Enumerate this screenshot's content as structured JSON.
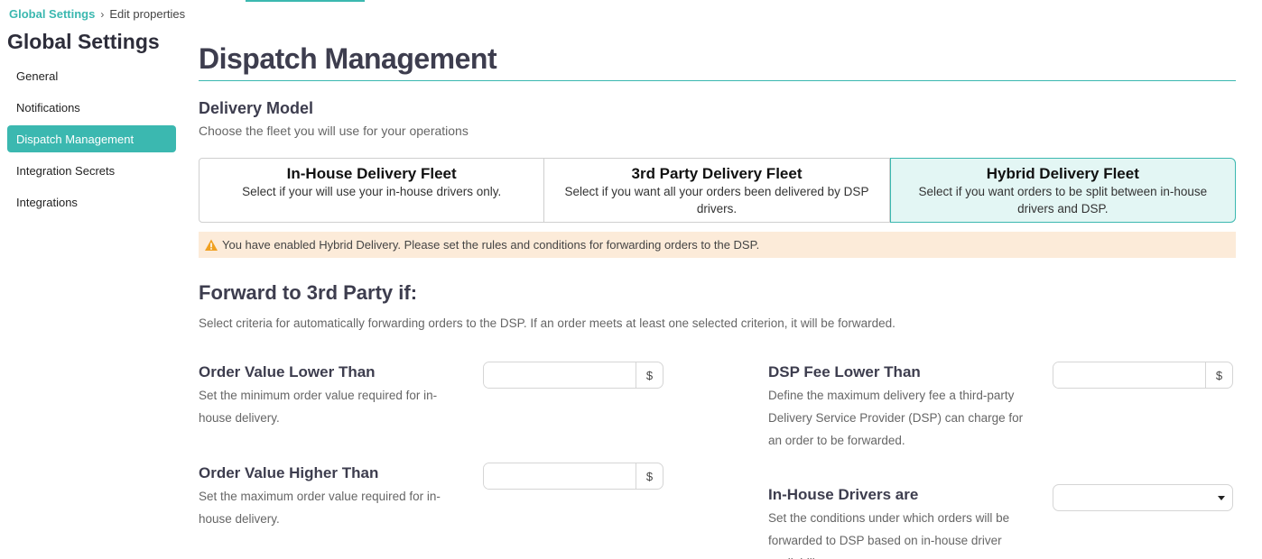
{
  "breadcrumb": {
    "root": "Global Settings",
    "separator": "›",
    "current": "Edit properties"
  },
  "sidebar": {
    "title": "Global Settings",
    "items": [
      {
        "label": "General",
        "active": false
      },
      {
        "label": "Notifications",
        "active": false
      },
      {
        "label": "Dispatch Management",
        "active": true
      },
      {
        "label": "Integration Secrets",
        "active": false
      },
      {
        "label": "Integrations",
        "active": false
      }
    ]
  },
  "page": {
    "title": "Dispatch Management"
  },
  "delivery_model": {
    "heading": "Delivery Model",
    "subtitle": "Choose the fleet you will use for your operations",
    "options": [
      {
        "title": "In-House Delivery Fleet",
        "description": "Select if your will use your in-house drivers only.",
        "selected": false
      },
      {
        "title": "3rd Party Delivery Fleet",
        "description": "Select if you want all your orders been delivered by DSP drivers.",
        "selected": false
      },
      {
        "title": "Hybrid Delivery Fleet",
        "description": "Select if you want orders to be split between in-house drivers and DSP.",
        "selected": true
      }
    ]
  },
  "alert": {
    "icon": "warning-icon",
    "text": "You have enabled Hybrid Delivery. Please set the rules and conditions for forwarding orders to the DSP."
  },
  "forward": {
    "heading": "Forward to 3rd Party if:",
    "subtitle": "Select criteria for automatically forwarding orders to the DSP. If an order meets at least one selected criterion, it will be forwarded.",
    "criteria": {
      "order_value_lower": {
        "title": "Order Value Lower Than",
        "description": "Set the minimum order value required for in-house delivery.",
        "value": "",
        "suffix": "$"
      },
      "order_value_higher": {
        "title": "Order Value Higher Than",
        "description": "Set the maximum order value required for in-house delivery.",
        "value": "",
        "suffix": "$"
      },
      "dsp_fee_lower": {
        "title": "DSP Fee Lower Than",
        "description": "Define the maximum delivery fee a third-party Delivery Service Provider (DSP) can charge for an order to be forwarded.",
        "value": "",
        "suffix": "$"
      },
      "in_house_drivers": {
        "title": "In-House Drivers are",
        "description": "Set the conditions under which orders will be forwarded to DSP based on in-house driver availability.",
        "selected": ""
      }
    }
  },
  "colors": {
    "accent": "#3bb8b0",
    "selected_card_bg": "#e3f6f4",
    "alert_bg": "#fcebd9",
    "warning": "#f0a020"
  }
}
